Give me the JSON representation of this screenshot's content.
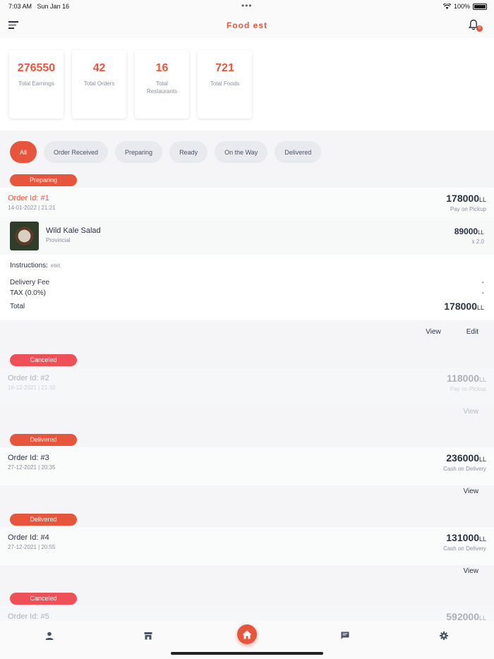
{
  "status_bar": {
    "time": "7:03 AM",
    "date": "Sun Jan 16",
    "battery": "100%"
  },
  "header": {
    "title": "Food est",
    "notification_count": "0"
  },
  "stats": [
    {
      "value": "276550",
      "label": "Total Earnings"
    },
    {
      "value": "42",
      "label": "Total Orders"
    },
    {
      "value": "16",
      "label": "Total Restaurants"
    },
    {
      "value": "721",
      "label": "Total Foods"
    }
  ],
  "filters": [
    "All",
    "Order Received",
    "Preparing",
    "Ready",
    "On the Way",
    "Delivered"
  ],
  "currency": "LL",
  "orders": [
    {
      "status": "Preparing",
      "id": "Order Id: #1",
      "date": "14-01-2022 | 21:21",
      "price": "178000",
      "payment": "Pay on Pickup",
      "item": {
        "name": "Wild Kale Salad",
        "category": "Provincial",
        "price": "89000",
        "qty": "x 2.0"
      },
      "instructions_label": "Instructions:",
      "instructions_value": "etet",
      "delivery_fee_label": "Delivery Fee",
      "delivery_fee_value": "-",
      "tax_label": "TAX (0.0%)",
      "tax_value": "-",
      "total_label": "Total",
      "total_value": "178000",
      "view_label": "View",
      "edit_label": "Edit"
    },
    {
      "status": "Canceled",
      "id": "Order Id: #2",
      "date": "16-12-2021 | 21:33",
      "price": "118000",
      "payment": "Pay on Pickup",
      "view_label": "View"
    },
    {
      "status": "Delivered",
      "id": "Order Id: #3",
      "date": "27-12-2021 | 20:35",
      "price": "236000",
      "payment": "Cash on Delivery",
      "view_label": "View"
    },
    {
      "status": "Delivered",
      "id": "Order Id: #4",
      "date": "27-12-2021 | 20:55",
      "price": "131000",
      "payment": "Cash on Delivery",
      "view_label": "View"
    },
    {
      "status": "Canceled",
      "id": "Order Id: #5",
      "price": "592000"
    }
  ],
  "colors": {
    "accent": "#e8553d",
    "canceled": "#ef4f57",
    "text": "#2b3343",
    "muted": "#8a919c"
  }
}
